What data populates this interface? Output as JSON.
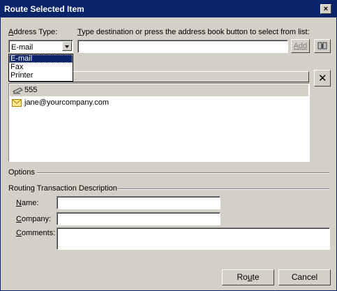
{
  "window": {
    "title": "Route Selected Item",
    "close_label": "×"
  },
  "address_type": {
    "label_prefix": "A",
    "label_rest": "ddress Type:",
    "value": "E-mail",
    "options": [
      "E-mail",
      "Fax",
      "Printer"
    ]
  },
  "destination": {
    "label_prefix": "T",
    "label_rest": "ype destination or press the address book button to select from list:",
    "value": "",
    "add_label": "Add"
  },
  "recipients": [
    {
      "text": "555",
      "icon": "fax-icon"
    },
    {
      "text": "jane@yourcompany.com",
      "icon": "email-envelope-icon"
    }
  ],
  "delete_label": "✕",
  "options": {
    "label": "Options"
  },
  "routing": {
    "label": "Routing Transaction Description",
    "name_prefix": "N",
    "name_rest": "ame:",
    "company_prefix": "C",
    "company_rest": "ompany:",
    "comments_prefix": "C",
    "comments_rest": "omments:",
    "name_value": "",
    "company_value": "",
    "comments_value": ""
  },
  "buttons": {
    "route_before": "Ro",
    "route_underline": "u",
    "route_after": "te",
    "cancel": "Cancel"
  },
  "colors": {
    "titlebar": "#0a246a",
    "face": "#d4d0c8",
    "selection": "#0a246a"
  }
}
